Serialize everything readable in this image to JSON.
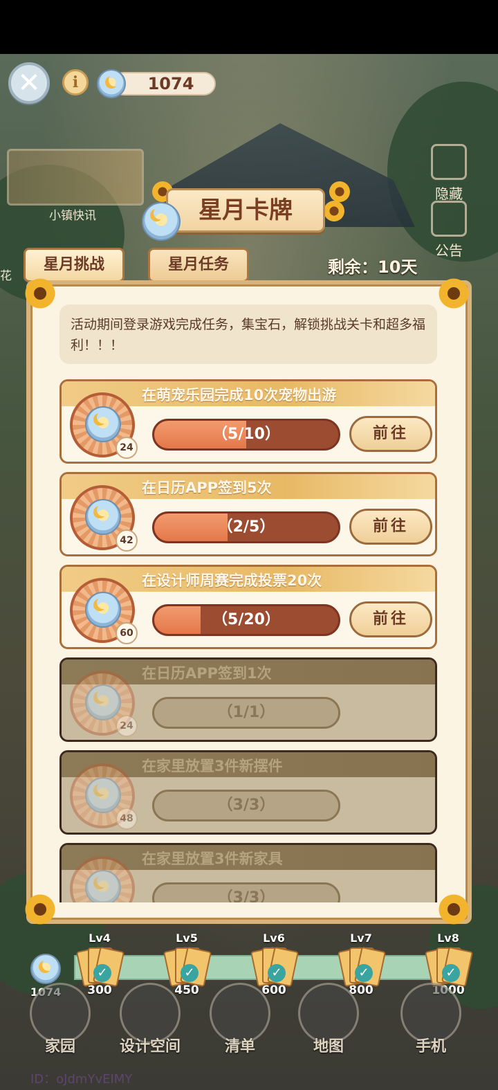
{
  "top": {
    "close_icon": "close-icon",
    "info_icon": "info-icon",
    "gem_count": "1074"
  },
  "news": {
    "label": "小镇快讯"
  },
  "side_buttons": [
    {
      "label": "隐藏",
      "icon": "hide-icon"
    },
    {
      "label": "公告",
      "icon": "announcement-icon"
    }
  ],
  "left_edge_text": "花",
  "header": {
    "title": "星月卡牌",
    "remaining": "剩余：10天"
  },
  "tabs": [
    {
      "label": "星月挑战",
      "active": true
    },
    {
      "label": "星月任务",
      "active": false
    }
  ],
  "description": "活动期间登录游戏完成任务，集宝石，解锁挑战关卡和超多福利！！！",
  "tasks": [
    {
      "title": "在萌宠乐园完成10次宠物出游",
      "reward": "24",
      "progress_text": "（5/10）",
      "progress": 0.5,
      "button": "前往",
      "done": false
    },
    {
      "title": "在日历APP签到5次",
      "reward": "42",
      "progress_text": "（2/5）",
      "progress": 0.4,
      "button": "前往",
      "done": false
    },
    {
      "title": "在设计师周赛完成投票20次",
      "reward": "60",
      "progress_text": "（5/20）",
      "progress": 0.25,
      "button": "前往",
      "done": false
    },
    {
      "title": "在日历APP签到1次",
      "reward": "24",
      "progress_text": "（1/1）",
      "progress": 1.0,
      "button": "",
      "done": true
    },
    {
      "title": "在家里放置3件新摆件",
      "reward": "48",
      "progress_text": "（3/3）",
      "progress": 1.0,
      "button": "",
      "done": true
    },
    {
      "title": "在家里放置3件新家具",
      "reward": "",
      "progress_text": "（3/3）",
      "progress": 1.0,
      "button": "",
      "done": true
    }
  ],
  "milestones": {
    "current": "1074",
    "items": [
      {
        "level": "Lv4",
        "value": "300"
      },
      {
        "level": "Lv5",
        "value": "450"
      },
      {
        "level": "Lv6",
        "value": "600"
      },
      {
        "level": "Lv7",
        "value": "800"
      },
      {
        "level": "Lv8",
        "value": "1000"
      }
    ]
  },
  "dock": [
    {
      "label": "家园"
    },
    {
      "label": "设计空间"
    },
    {
      "label": "清单"
    },
    {
      "label": "地图"
    },
    {
      "label": "手机"
    }
  ],
  "user_id": "ID：oJdmYvEIMY",
  "colors": {
    "panel_bg": "#fbf4e3",
    "accent": "#a86f3a",
    "progress_fill": "#e4784a"
  }
}
